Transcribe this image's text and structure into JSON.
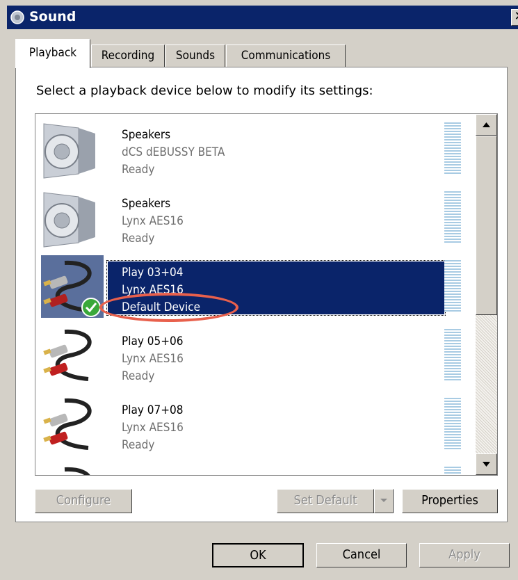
{
  "window": {
    "title": "Sound",
    "close": "✕"
  },
  "tabs": [
    {
      "label": "Playback",
      "active": true
    },
    {
      "label": "Recording",
      "active": false
    },
    {
      "label": "Sounds",
      "active": false
    },
    {
      "label": "Communications",
      "active": false
    }
  ],
  "instruction": "Select a playback device below to modify its settings:",
  "devices": [
    {
      "name": "Speakers",
      "driver": "dCS dEBUSSY BETA",
      "status": "Ready",
      "icon": "speaker-icon"
    },
    {
      "name": "Speakers",
      "driver": "Lynx AES16",
      "status": "Ready",
      "icon": "speaker-icon"
    },
    {
      "name": "Play 03+04",
      "driver": "Lynx AES16",
      "status": "Default Device",
      "icon": "rca-cable-icon",
      "selected": true,
      "default": true
    },
    {
      "name": "Play 05+06",
      "driver": "Lynx AES16",
      "status": "Ready",
      "icon": "rca-cable-icon"
    },
    {
      "name": "Play 07+08",
      "driver": "Lynx AES16",
      "status": "Ready",
      "icon": "rca-cable-icon"
    }
  ],
  "buttons": {
    "configure": "Configure",
    "set_default": "Set Default",
    "properties": "Properties",
    "ok": "OK",
    "cancel": "Cancel",
    "apply": "Apply"
  },
  "colors": {
    "selection": "#0a246a",
    "callout": "#e8604c",
    "meter": "#a8cbe3"
  }
}
